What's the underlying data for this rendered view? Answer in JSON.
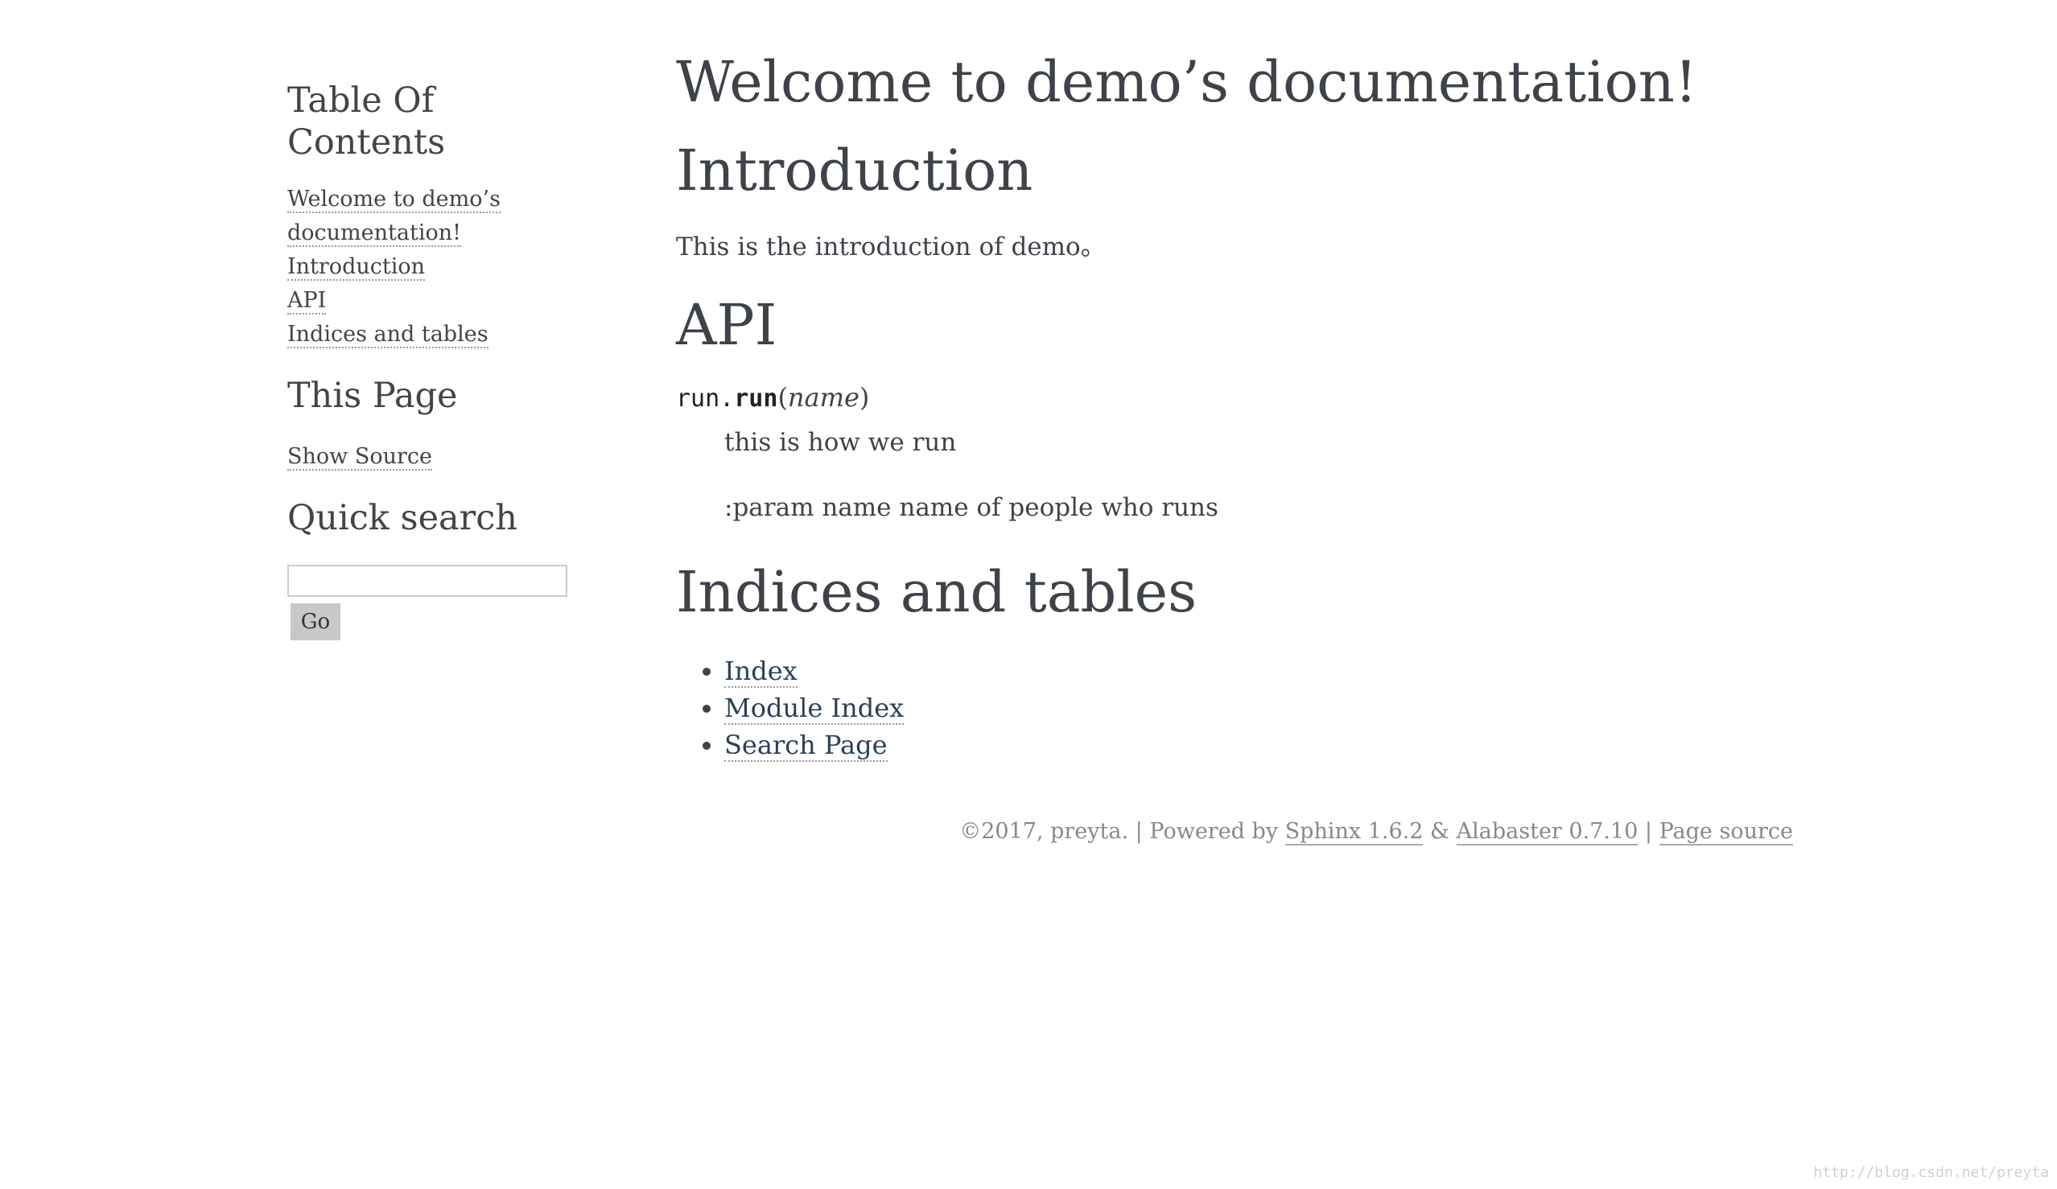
{
  "sidebar": {
    "toc_title": "Table Of Contents",
    "toc_items": [
      {
        "label": "Welcome to demo’s documentation!"
      },
      {
        "label": "Introduction"
      },
      {
        "label": "API"
      },
      {
        "label": "Indices and tables"
      }
    ],
    "this_page_title": "This Page",
    "show_source_label": "Show Source",
    "quick_search_title": "Quick search",
    "search_placeholder": "",
    "go_label": "Go"
  },
  "main": {
    "title": "Welcome to demo’s documentation!",
    "intro_heading": "Introduction",
    "intro_text": "This is the introduction of demo。",
    "api_heading": "API",
    "signature": {
      "module": "run.",
      "function": "run",
      "open_paren": "(",
      "param": "name",
      "close_paren": ")"
    },
    "desc_line1": "this is how we run",
    "desc_line2": ":param name name of people who runs",
    "indices_heading": "Indices and tables",
    "indices_links": [
      {
        "label": "Index"
      },
      {
        "label": "Module Index"
      },
      {
        "label": "Search Page"
      }
    ]
  },
  "footer": {
    "copyright": "©2017, preyta.",
    "sep1": "|",
    "powered_by": "Powered by",
    "sphinx_link": "Sphinx 1.6.2",
    "amp": "&",
    "alabaster_link": "Alabaster 0.7.10",
    "sep2": "|",
    "page_source_link": "Page source"
  },
  "watermark": "http://blog.csdn.net/preyta"
}
